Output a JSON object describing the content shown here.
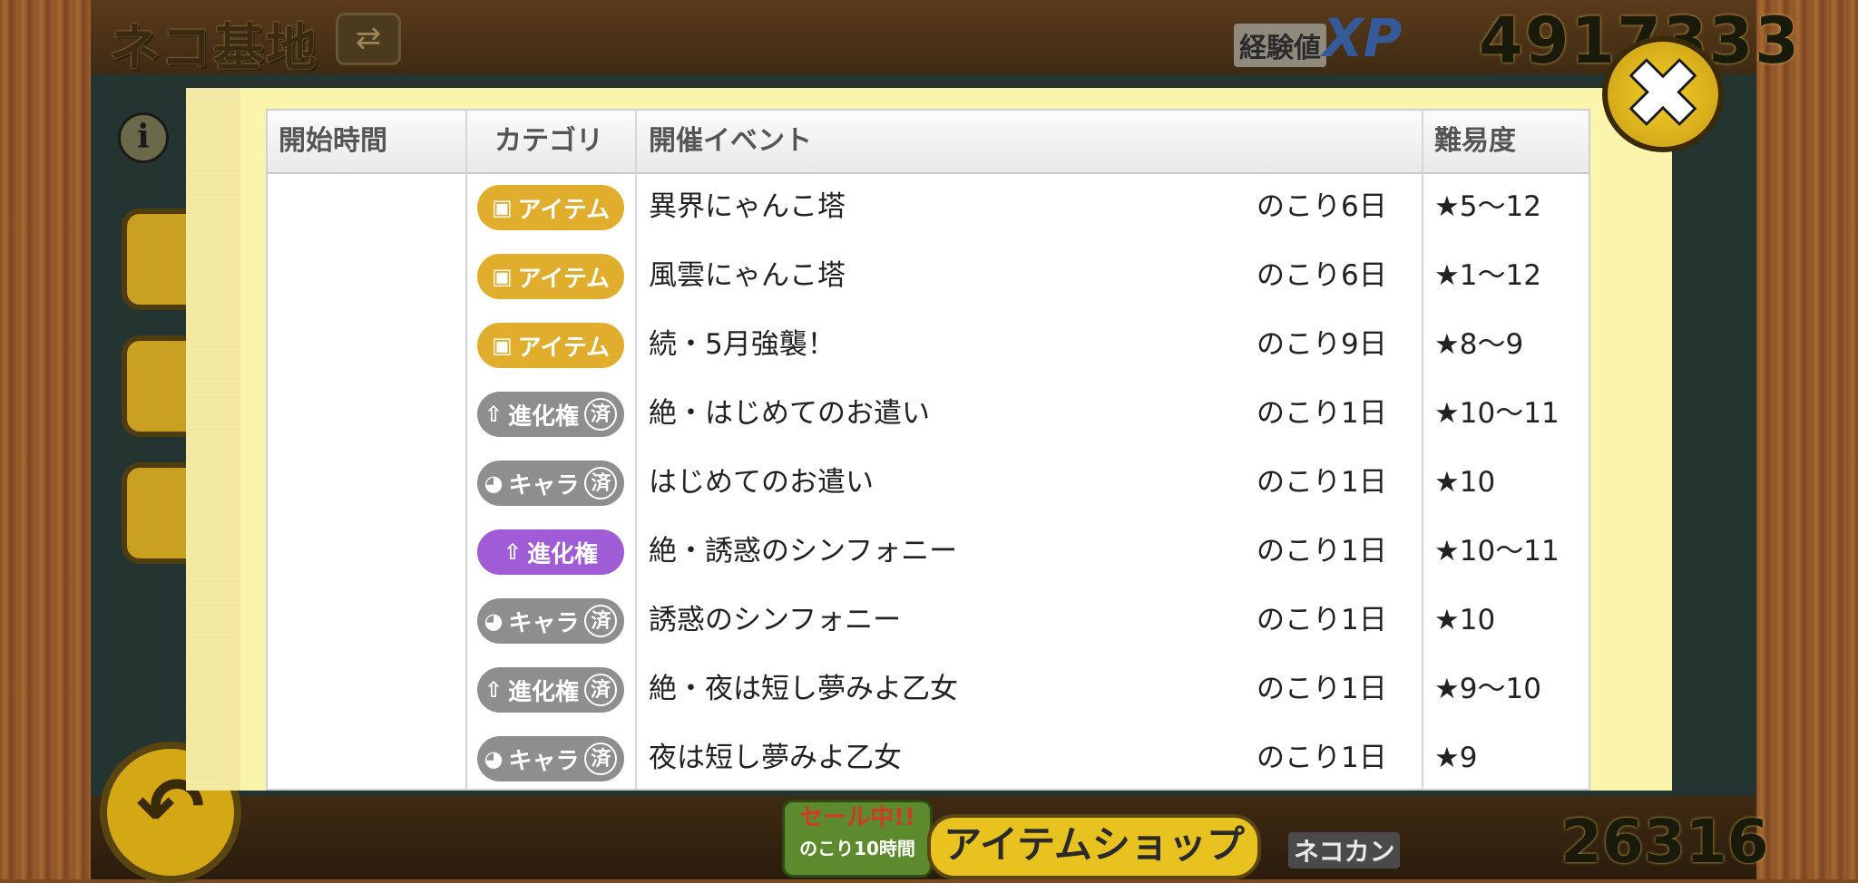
{
  "header": {
    "title": "ネコ基地",
    "swap_icon": "⇄",
    "xp_label": "経験値",
    "xp_badge": "XP",
    "xp_value": "4917333"
  },
  "footer": {
    "sale_text": "セール中!!",
    "sale_sub": "のこり10時間",
    "shop_label": "アイテムショップ",
    "nekokan_label": "ネコカン",
    "nekokan_value": "26316",
    "back_icon": "↶"
  },
  "info_icon": "i",
  "close_icon": "✖",
  "table": {
    "headers": {
      "start_time": "開始時間",
      "category": "カテゴリ",
      "event": "開催イベント",
      "difficulty": "難易度"
    },
    "rows": [
      {
        "category": "アイテム",
        "cat_type": "item",
        "done": false,
        "event": "異界にゃんこ塔",
        "remaining": "のこり6日",
        "difficulty": "★5〜12"
      },
      {
        "category": "アイテム",
        "cat_type": "item",
        "done": false,
        "event": "風雲にゃんこ塔",
        "remaining": "のこり6日",
        "difficulty": "★1〜12"
      },
      {
        "category": "アイテム",
        "cat_type": "item",
        "done": false,
        "event": "続・5月強襲！",
        "remaining": "のこり9日",
        "difficulty": "★8〜9"
      },
      {
        "category": "進化権",
        "cat_type": "evolve",
        "done": true,
        "event": "絶・はじめてのお遣い",
        "remaining": "のこり1日",
        "difficulty": "★10〜11"
      },
      {
        "category": "キャラ",
        "cat_type": "chara",
        "done": true,
        "event": "はじめてのお遣い",
        "remaining": "のこり1日",
        "difficulty": "★10"
      },
      {
        "category": "進化権",
        "cat_type": "evolve",
        "done": false,
        "event": "絶・誘惑のシンフォニー",
        "remaining": "のこり1日",
        "difficulty": "★10〜11"
      },
      {
        "category": "キャラ",
        "cat_type": "chara",
        "done": true,
        "event": "誘惑のシンフォニー",
        "remaining": "のこり1日",
        "difficulty": "★10"
      },
      {
        "category": "進化権",
        "cat_type": "evolve",
        "done": true,
        "event": "絶・夜は短し夢みよ乙女",
        "remaining": "のこり1日",
        "difficulty": "★9〜10"
      },
      {
        "category": "キャラ",
        "cat_type": "chara",
        "done": true,
        "event": "夜は短し夢みよ乙女",
        "remaining": "のこり1日",
        "difficulty": "★9"
      }
    ],
    "done_mark": "済"
  },
  "colors": {
    "item": "#e1ad2c",
    "evolve": "#a05cd6",
    "done": "#8e8e8e"
  }
}
